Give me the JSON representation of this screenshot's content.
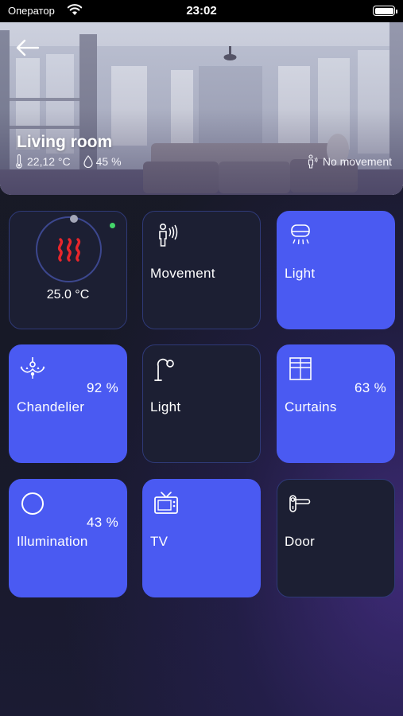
{
  "status_bar": {
    "carrier": "Оператор",
    "time": "23:02"
  },
  "room": {
    "title": "Living room",
    "temperature": "22,12 °C",
    "humidity": "45 %",
    "movement_status": "No movement"
  },
  "tiles": [
    {
      "name": "thermostat",
      "temperature": "25.0 °C",
      "state": "off",
      "icon": "heater-icon"
    },
    {
      "name": "movement",
      "label": "Movement",
      "state": "off",
      "icon": "motion-sensor-icon"
    },
    {
      "name": "light-1",
      "label": "Light",
      "state": "on",
      "icon": "ceiling-light-icon"
    },
    {
      "name": "chandelier",
      "label": "Chandelier",
      "value": "92 %",
      "state": "on",
      "icon": "chandelier-icon"
    },
    {
      "name": "light-2",
      "label": "Light",
      "state": "off",
      "icon": "floor-lamp-icon"
    },
    {
      "name": "curtains",
      "label": "Curtains",
      "value": "63 %",
      "state": "on",
      "icon": "curtains-icon"
    },
    {
      "name": "illumination",
      "label": "Illumination",
      "value": "43 %",
      "state": "on",
      "icon": "circle-icon"
    },
    {
      "name": "tv",
      "label": "TV",
      "state": "on",
      "icon": "tv-icon"
    },
    {
      "name": "door",
      "label": "Door",
      "state": "off",
      "icon": "door-handle-icon"
    }
  ],
  "colors": {
    "tile_on": "#4a5af2",
    "tile_off": "#1c1f33",
    "tile_off_border": "#2f3a78",
    "heater_red": "#e8262b",
    "online_green": "#44d66a"
  }
}
